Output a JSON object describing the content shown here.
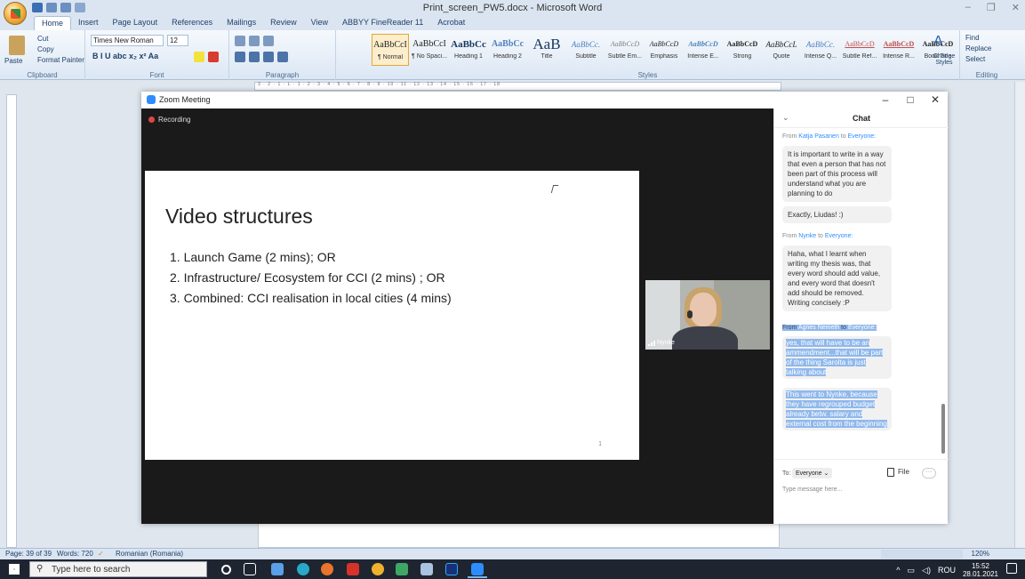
{
  "word": {
    "title": "Print_screen_PW5.docx - Microsoft Word",
    "tabs": [
      "Home",
      "Insert",
      "Page Layout",
      "References",
      "Mailings",
      "Review",
      "View",
      "ABBYY FineReader 11",
      "Acrobat"
    ],
    "clipboard": {
      "cut": "Cut",
      "copy": "Copy",
      "paste": "Paste",
      "format_painter": "Format Painter",
      "label": "Clipboard"
    },
    "font": {
      "name": "Times New Roman",
      "size": "12",
      "label": "Font"
    },
    "paragraph_label": "Paragraph",
    "styles_label": "Styles",
    "styles": [
      {
        "preview": "AaBbCcI",
        "name": "¶ Normal"
      },
      {
        "preview": "AaBbCcI",
        "name": "¶ No Spaci..."
      },
      {
        "preview": "AaBbCc",
        "name": "Heading 1"
      },
      {
        "preview": "AaBbCc",
        "name": "Heading 2"
      },
      {
        "preview": "AaB",
        "name": "Title"
      },
      {
        "preview": "AaBbCc.",
        "name": "Subtitle"
      },
      {
        "preview": "AaBbCcD",
        "name": "Subtle Em..."
      },
      {
        "preview": "AaBbCcD",
        "name": "Emphasis"
      },
      {
        "preview": "AaBbCcD",
        "name": "Intense E..."
      },
      {
        "preview": "AaBbCcD",
        "name": "Strong"
      },
      {
        "preview": "AaBbCcL",
        "name": "Quote"
      },
      {
        "preview": "AaBbCc.",
        "name": "Intense Q..."
      },
      {
        "preview": "AaBbCcD",
        "name": "Subtle Ref..."
      },
      {
        "preview": "AaBbCcD",
        "name": "Intense R..."
      },
      {
        "preview": "AaBbCcD",
        "name": "Book Title"
      }
    ],
    "change_styles": "Change Styles",
    "editing": {
      "find": "Find",
      "replace": "Replace",
      "select": "Select",
      "label": "Editing"
    },
    "ruler_text": "3 · 2 · 1 · L · 1 · 2 · 3 · 4 · 5 · 6 · 7 · 8 · 9 · 10 · 11 · 12 · 13 · 14 · 15 · 16 · 17 · 18",
    "status": {
      "page": "Page: 39 of 39",
      "words": "Words: 720",
      "language": "Romanian (Romania)",
      "zoom": "120%"
    }
  },
  "zoom": {
    "title": "Zoom Meeting",
    "recording": "Recording",
    "slide": {
      "title": "Video structures",
      "items": [
        "1.  Launch Game (2 mins); OR",
        "2.  Infrastructure/ Ecosystem for CCI (2 mins) ; OR",
        "3.  Combined: CCI realisation in local cities (4 mins)"
      ],
      "page_number": "1"
    },
    "video_participant": "Nynke",
    "chat": {
      "title": "Chat",
      "from": "From",
      "to": "to",
      "everyone": "Everyone:",
      "senders": [
        "Katja Pasanen",
        "Nynke",
        "Agnes Nemeth"
      ],
      "messages": [
        "It is important to write in a way that even a person that has not been part of this process will understand what you are planning to do",
        "Exactly, Liudas! :)",
        "Haha, what I learnt when writing my thesis was, that every word should add value, and every word that doesn't add should be removed. Writing concisely :P",
        "yes, that will have to be an ammendment...that will be part of the thing Sarolta is just talking about",
        "This went to Nynke, because they have regrouped budget already betw. salary and external cost from the beginning"
      ],
      "to_label": "To:",
      "to_value": "Everyone",
      "file_label": "File",
      "more_label": "···",
      "input_placeholder": "Type message here..."
    }
  },
  "taskbar": {
    "search_placeholder": "Type here to search",
    "language": "ROU",
    "time": "15:52",
    "date": "28.01.2021"
  }
}
